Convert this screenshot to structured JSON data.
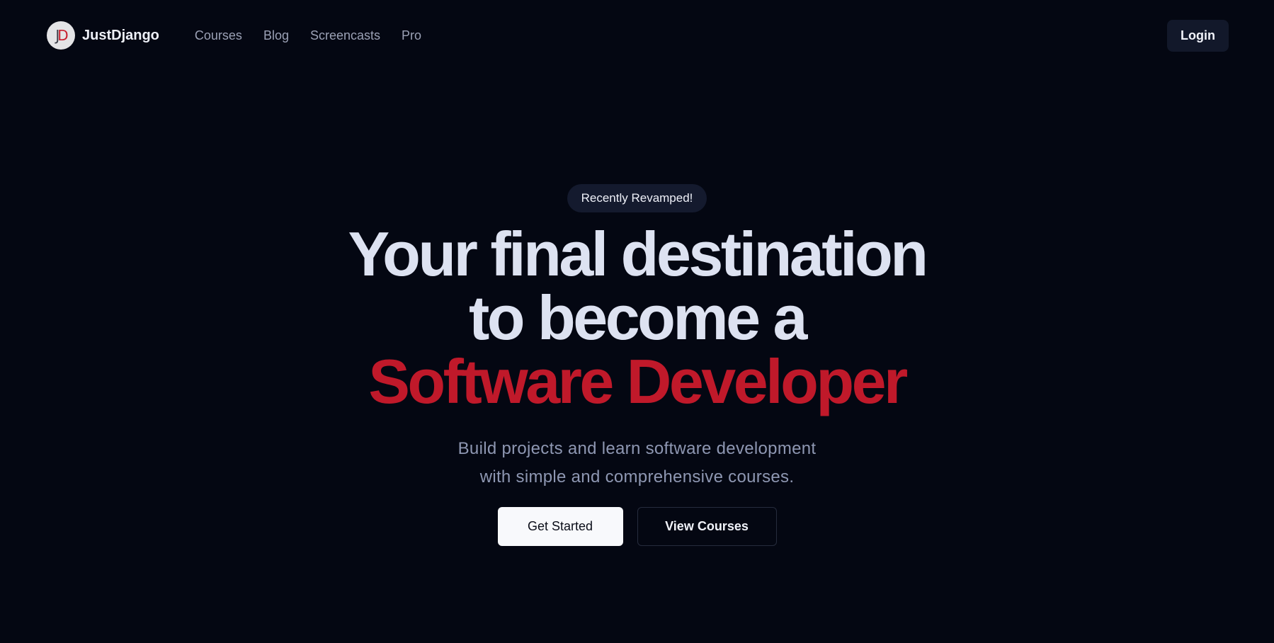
{
  "header": {
    "logo_letters": {
      "j": "J",
      "d": "D"
    },
    "brand_name": "JustDjango",
    "nav": [
      "Courses",
      "Blog",
      "Screencasts",
      "Pro"
    ],
    "login_label": "Login"
  },
  "hero": {
    "badge": "Recently Revamped!",
    "headline_line1": "Your final destination",
    "headline_line2": "to become a",
    "headline_accent": "Software Developer",
    "subtitle_line1": "Build projects and learn software development",
    "subtitle_line2": "with simple and comprehensive courses.",
    "primary_cta": "Get Started",
    "secondary_cta": "View Courses"
  },
  "colors": {
    "background": "#040712",
    "accent_red": "#c0192a",
    "headline": "#dde2f1",
    "muted_text": "#8e97b2",
    "nav_text": "#9ba1b5"
  }
}
